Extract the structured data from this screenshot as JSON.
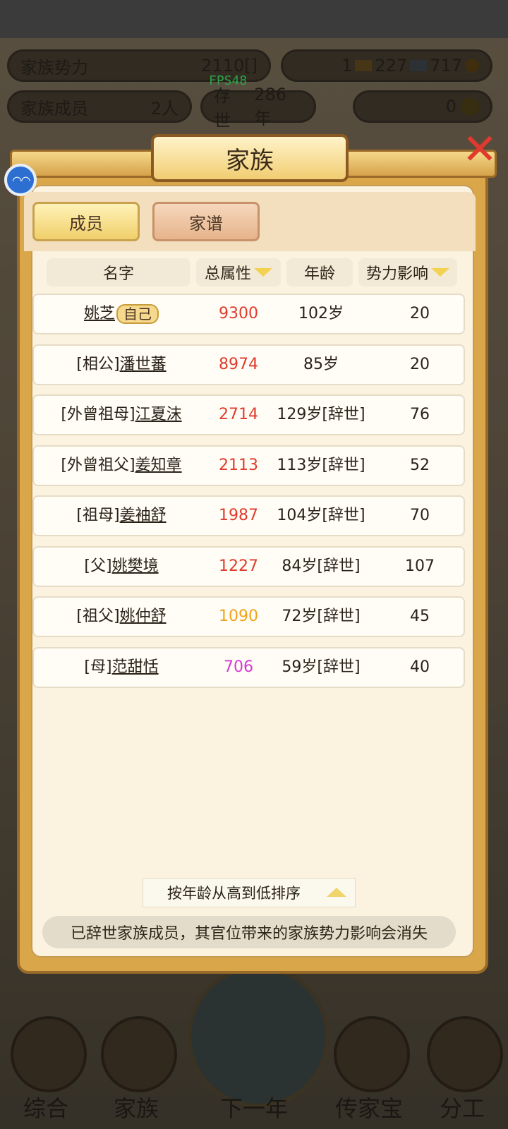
{
  "top_stats": {
    "family_power_label": "家族势力",
    "family_power_value": "2110[",
    "family_power_tail": "]",
    "gold_count": "1",
    "silver_count": "227",
    "ingot_count": "717",
    "members_label": "家族成员",
    "members_value": "2人",
    "exist_label": "存世",
    "exist_value": "286年",
    "yuanbao_value": "0",
    "fps": "FPS48"
  },
  "panel": {
    "title": "家族",
    "tabs": [
      {
        "label": "成员",
        "active": true
      },
      {
        "label": "家谱",
        "active": false
      }
    ]
  },
  "table": {
    "headers": {
      "name": "名字",
      "total": "总属性",
      "age": "年龄",
      "influence": "势力影响"
    },
    "self_badge": "自己",
    "rows": [
      {
        "prefix": "",
        "name": "姚芝",
        "total": "9300",
        "age": "102岁",
        "influence": "20",
        "color": "#e03b2e"
      },
      {
        "prefix": "[相公]",
        "name": "潘世蕃",
        "total": "8974",
        "age": "85岁",
        "influence": "20",
        "color": "#e03b2e"
      },
      {
        "prefix": "[外曾祖母]",
        "name": "江夏沫",
        "total": "2714",
        "age": "129岁[辞世]",
        "influence": "76",
        "color": "#e03b2e"
      },
      {
        "prefix": "[外曾祖父]",
        "name": "姜知章",
        "total": "2113",
        "age": "113岁[辞世]",
        "influence": "52",
        "color": "#e03b2e"
      },
      {
        "prefix": "[祖母]",
        "name": "姜袖舒",
        "total": "1987",
        "age": "104岁[辞世]",
        "influence": "70",
        "color": "#e03b2e"
      },
      {
        "prefix": "[父]",
        "name": "姚樊境",
        "total": "1227",
        "age": "84岁[辞世]",
        "influence": "107",
        "color": "#e03b2e"
      },
      {
        "prefix": "[祖父]",
        "name": "姚仲舒",
        "total": "1090",
        "age": "72岁[辞世]",
        "influence": "45",
        "color": "#f2a21a"
      },
      {
        "prefix": "[母]",
        "name": "范甜恬",
        "total": "706",
        "age": "59岁[辞世]",
        "influence": "40",
        "color": "#d63ad6"
      }
    ]
  },
  "sort": {
    "label": "按年龄从高到低排序"
  },
  "notice": "已辞世家族成员，其官位带来的家族势力影响会消失",
  "nav": {
    "items": [
      "综合",
      "家族",
      "下一年",
      "传家宝",
      "分工"
    ]
  }
}
